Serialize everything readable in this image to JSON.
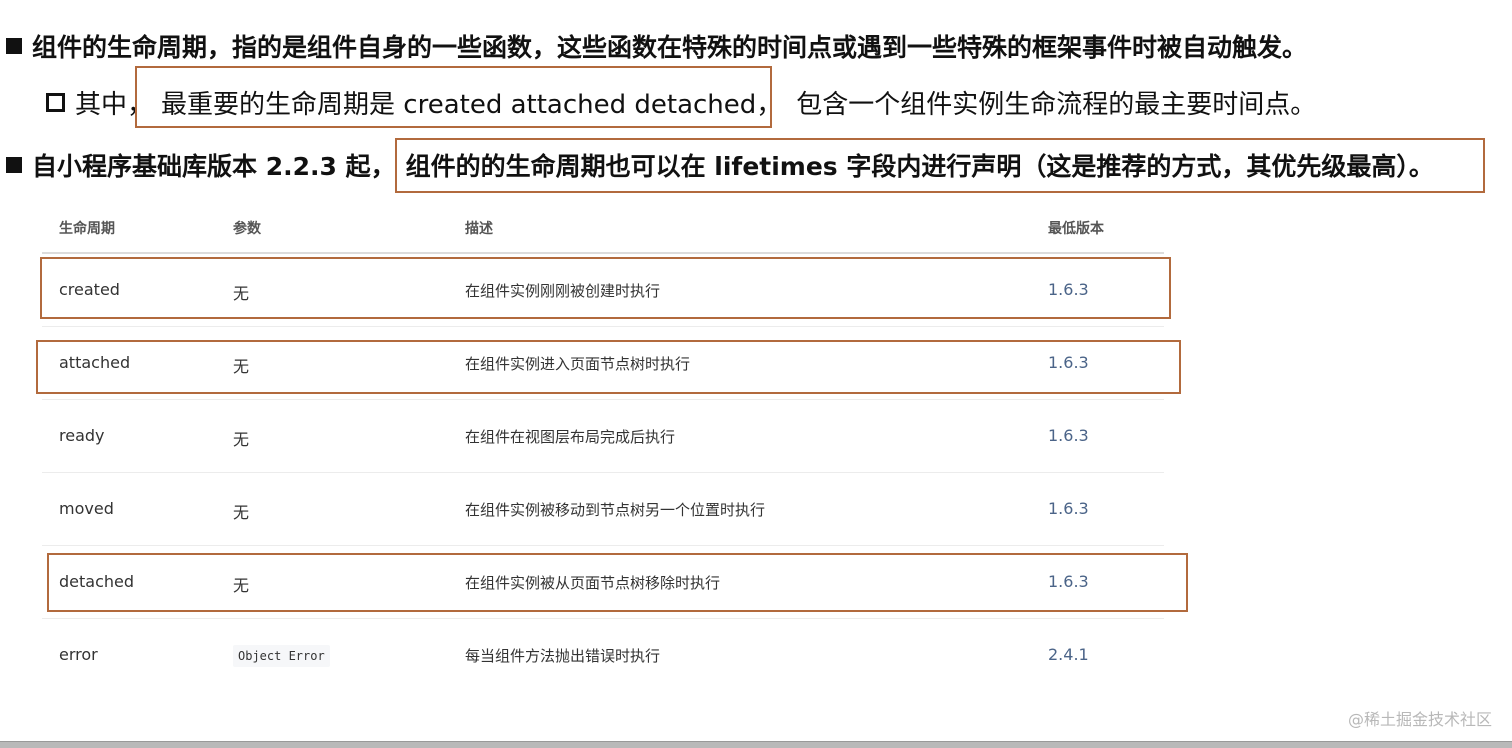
{
  "bullets": {
    "line1": "组件的生命周期，指的是组件自身的一些函数，这些函数在特殊的时间点或遇到一些特殊的框架事件时被自动触发。",
    "line2_prefix": "其中，",
    "line2_highlight": "最重要的生命周期是 created attached detached，",
    "line2_suffix": "包含一个组件实例生命流程的最主要时间点。",
    "line3_prefix": "自小程序基础库版本 2.2.3 起，",
    "line3_highlight": "组件的的生命周期也可以在 lifetimes 字段内进行声明（这是推荐的方式，其优先级最高）。"
  },
  "table": {
    "headers": [
      "生命周期",
      "参数",
      "描述",
      "最低版本"
    ],
    "rows": [
      {
        "name": "created",
        "param": "无",
        "desc": "在组件实例刚刚被创建时执行",
        "version": "1.6.3"
      },
      {
        "name": "attached",
        "param": "无",
        "desc": "在组件实例进入页面节点树时执行",
        "version": "1.6.3"
      },
      {
        "name": "ready",
        "param": "无",
        "desc": "在组件在视图层布局完成后执行",
        "version": "1.6.3"
      },
      {
        "name": "moved",
        "param": "无",
        "desc": "在组件实例被移动到节点树另一个位置时执行",
        "version": "1.6.3"
      },
      {
        "name": "detached",
        "param": "无",
        "desc": "在组件实例被从页面节点树移除时执行",
        "version": "1.6.3"
      },
      {
        "name": "error",
        "param": "Object Error",
        "desc": "每当组件方法抛出错误时执行",
        "version": "2.4.1"
      }
    ]
  },
  "watermark": "@稀土掘金技术社区",
  "colors": {
    "highlight_border": "#b26a3d",
    "version_text": "#4b6488"
  }
}
